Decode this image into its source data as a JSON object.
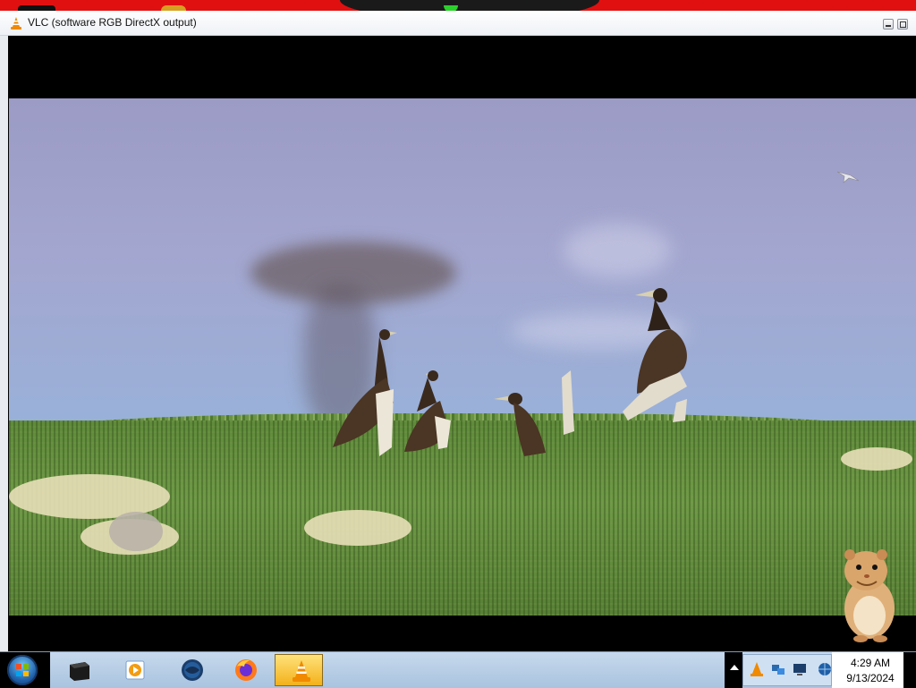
{
  "window": {
    "title": "VLC (software RGB DirectX output)",
    "app_icon": "vlc-cone-icon"
  },
  "video": {
    "description_icon": "video-frame"
  },
  "taskbar": {
    "start_icon": "windows-start-orb-icon",
    "pinned": [
      {
        "name": "terminal-icon"
      },
      {
        "name": "media-player-icon"
      },
      {
        "name": "globe-icon"
      },
      {
        "name": "firefox-icon"
      },
      {
        "name": "vlc-cone-icon",
        "active": true
      }
    ],
    "tray_icons": [
      "show-hidden-icons-arrow",
      "vlc-tray-icon",
      "network-tray-icon",
      "display-tray-icon",
      "globe-tray-icon"
    ],
    "clock": {
      "time": "4:29 AM",
      "date": "9/13/2024"
    }
  },
  "colors": {
    "accent": "#e01010",
    "taskbar": "#b9cfe7",
    "active_button": "#f3b11a"
  }
}
